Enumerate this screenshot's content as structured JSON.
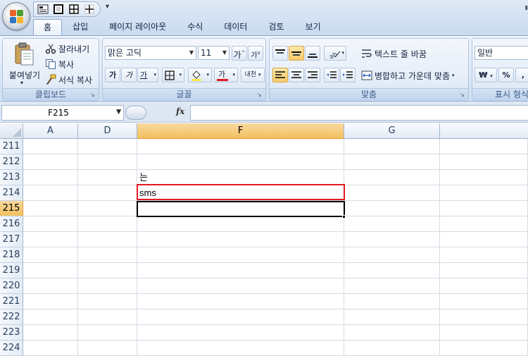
{
  "quick_access": {
    "more_glyph": "▾",
    "right_mark": "▮"
  },
  "tabs": [
    {
      "label": "홈",
      "active": true
    },
    {
      "label": "삽입"
    },
    {
      "label": "페이지 레이아웃"
    },
    {
      "label": "수식"
    },
    {
      "label": "데이터"
    },
    {
      "label": "검토"
    },
    {
      "label": "보기"
    }
  ],
  "ribbon": {
    "clipboard": {
      "label": "클립보드",
      "paste_label": "붙여넣기",
      "cut_label": "잘라내기",
      "copy_label": "복사",
      "format_painter_label": "서식 복사"
    },
    "font": {
      "label": "글꼴",
      "font_name": "맑은 고딕",
      "font_size": "11",
      "grow_glyph": "가",
      "shrink_glyph": "가",
      "bold_glyph": "가",
      "italic_glyph": "가",
      "underline_glyph": "가",
      "font_color_glyph": "가",
      "phonetic_glyph": "내천"
    },
    "alignment": {
      "label": "맞춤",
      "wrap_text_label": "텍스트 줄 바꿈",
      "merge_center_label": "병합하고 가운데 맞춤"
    },
    "number": {
      "label": "표시 형식",
      "format_value": "일반",
      "currency_glyph": "₩",
      "percent_glyph": "%",
      "comma_glyph": ","
    }
  },
  "formula_bar": {
    "name_box_value": "F215",
    "fx_label": "fx",
    "formula_value": ""
  },
  "sheet": {
    "columns": [
      "A",
      "D",
      "F",
      "G"
    ],
    "selected_column": "F",
    "rows": [
      "211",
      "212",
      "213",
      "214",
      "215",
      "216",
      "217",
      "218",
      "219",
      "220",
      "221",
      "222",
      "223",
      "224"
    ],
    "selected_row": "215",
    "cells": {
      "F213": "는",
      "F214": "sms",
      "F215": ""
    }
  },
  "colors": {
    "selection_highlight": "#f1c15f",
    "annotation_box": "#e01a22"
  }
}
